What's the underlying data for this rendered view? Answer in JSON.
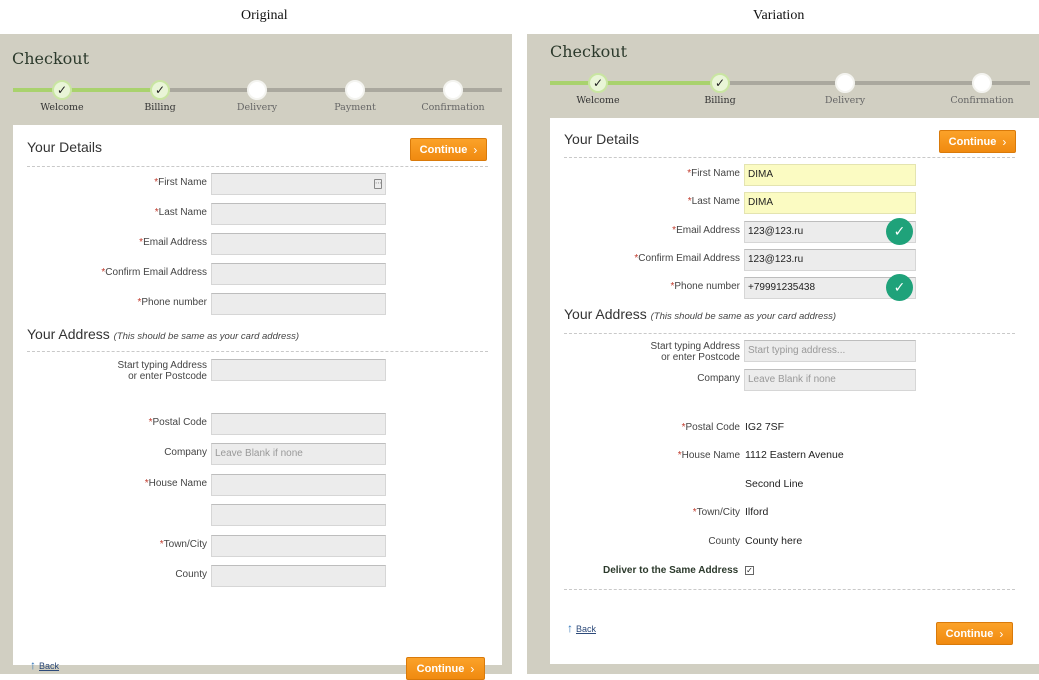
{
  "captions": {
    "original": "Original",
    "variation": "Variation"
  },
  "colors": {
    "panel_bg": "#d1cfc2",
    "accent": "#f08a10",
    "progress": "#a9d26d",
    "valid": "#1fa27a",
    "required": "#c0392b"
  },
  "original": {
    "title": "Checkout",
    "steps": [
      {
        "label": "Welcome",
        "done": true,
        "mark": "✓"
      },
      {
        "label": "Billing",
        "done": true,
        "mark": "✓"
      },
      {
        "label": "Delivery",
        "done": false,
        "mark": ""
      },
      {
        "label": "Payment",
        "done": false,
        "mark": ""
      },
      {
        "label": "Confirmation",
        "done": false,
        "mark": ""
      }
    ],
    "details_title": "Your Details",
    "continue": "Continue",
    "chevron": "›",
    "req_mark": "*",
    "fields": {
      "first_name": {
        "label": "First Name",
        "value": ""
      },
      "last_name": {
        "label": "Last Name",
        "value": ""
      },
      "email": {
        "label": "Email Address",
        "value": ""
      },
      "confirm_email": {
        "label": "Confirm Email Address",
        "value": ""
      },
      "phone": {
        "label": "Phone number",
        "value": ""
      }
    },
    "address_title": "Your Address",
    "address_note": "(This should be same as your card address)",
    "lookup_label_1": "Start typing Address",
    "lookup_label_2": "or enter Postcode",
    "postal_label": "Postal Code",
    "company_label": "Company",
    "company_placeholder": "Leave Blank if none",
    "house_label": "House Name",
    "town_label": "Town/City",
    "county_label": "County",
    "back": "Back",
    "back_arrow": "↑"
  },
  "variation": {
    "title": "Checkout",
    "steps": [
      {
        "label": "Welcome",
        "done": true,
        "mark": "✓"
      },
      {
        "label": "Billing",
        "done": true,
        "mark": "✓"
      },
      {
        "label": "Delivery",
        "done": false,
        "mark": ""
      },
      {
        "label": "Confirmation",
        "done": false,
        "mark": ""
      }
    ],
    "details_title": "Your Details",
    "continue": "Continue",
    "chevron": "›",
    "req_mark": "*",
    "fields": {
      "first_name": {
        "label": "First Name",
        "value": "DIMA"
      },
      "last_name": {
        "label": "Last Name",
        "value": "DIMA"
      },
      "email": {
        "label": "Email Address",
        "value": "123@123.ru"
      },
      "confirm_email": {
        "label": "Confirm Email Address",
        "value": "123@123.ru"
      },
      "phone": {
        "label": "Phone number",
        "value": "+79991235438"
      }
    },
    "valid_mark": "✓",
    "address_title": "Your Address",
    "address_note": "(This should be same as your card address)",
    "lookup_label_1": "Start typing Address",
    "lookup_label_2": "or enter Postcode",
    "lookup_placeholder": "Start typing address...",
    "company_label": "Company",
    "company_placeholder": "Leave Blank if none",
    "postal_label": "Postal Code",
    "postal_value": "IG2 7SF",
    "house_label": "House Name",
    "house_value": "1112 Eastern Avenue",
    "second_line_value": "Second Line",
    "town_label": "Town/City",
    "town_value": "Ilford",
    "county_label": "County",
    "county_value": "County here",
    "same_address_label": "Deliver to the Same Address",
    "same_address_checked": "✓",
    "back": "Back",
    "back_arrow": "↑"
  }
}
